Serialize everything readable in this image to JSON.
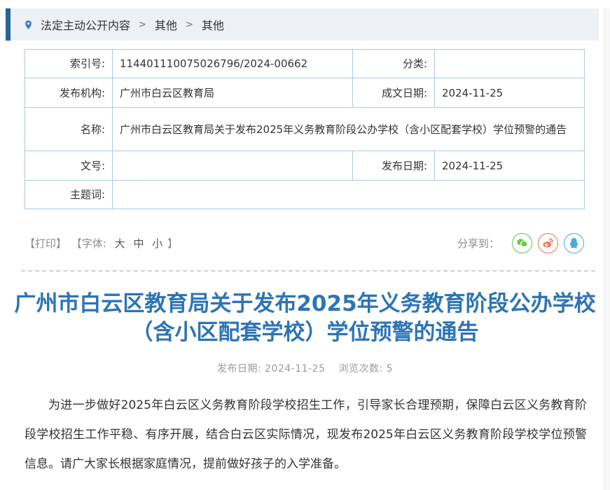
{
  "breadcrumb": {
    "items": [
      "法定主动公开内容",
      "其他",
      "其他"
    ],
    "separator": ">"
  },
  "doc_table": {
    "rows": [
      {
        "label1": "索引号:",
        "value1": "114401110075026796/2024-00662",
        "label2": "分类:",
        "value2": ""
      },
      {
        "label1": "发布机构:",
        "value1": "广州市白云区教育局",
        "label2": "成文日期:",
        "value2": "2024-11-25"
      },
      {
        "label1": "名称:",
        "value1": "广州市白云区教育局关于发布2025年义务教育阶段公办学校（含小区配套学校）学位预警的通告"
      },
      {
        "label1": "文号:",
        "value1": "",
        "label2": "发布日期:",
        "value2": "2024-11-25"
      },
      {
        "label1": "主题词:",
        "value1": ""
      }
    ]
  },
  "tools": {
    "print_label": "【打印】",
    "font_prefix": "【字体:",
    "font_large": "大",
    "font_medium": "中",
    "font_small": "小",
    "font_suffix": "】",
    "share_label": "分享到：",
    "share_icons": [
      "wechat-icon",
      "weibo-icon",
      "qq-icon"
    ]
  },
  "article": {
    "title": "广州市白云区教育局关于发布2025年义务教育阶段公办学校（含小区配套学校）学位预警的通告",
    "publish_label": "发布日期:",
    "publish_date": "2024-11-25",
    "views_label": "浏览次数:",
    "views_count": "5",
    "paragraph": "为进一步做好2025年白云区义务教育阶段学校招生工作，引导家长合理预期，保障白云区义务教育阶段学校招生工作平稳、有序开展，结合白云区实际情况，现发布2025年白云区义务教育阶段学校学位预警信息。请广大家长根据家庭情况，提前做好孩子的入学准备。"
  },
  "colors": {
    "title_blue": "#2d74b5",
    "table_border": "#a9c9e8",
    "breadcrumb_bar_bg": "#edf0f4",
    "breadcrumb_accent_navy": "#2a6496",
    "pin_blue": "#3b7dbd",
    "wechat_green": "#62c142",
    "weibo_orange": "#f2704f",
    "qq_blue": "#4aa9e0"
  }
}
